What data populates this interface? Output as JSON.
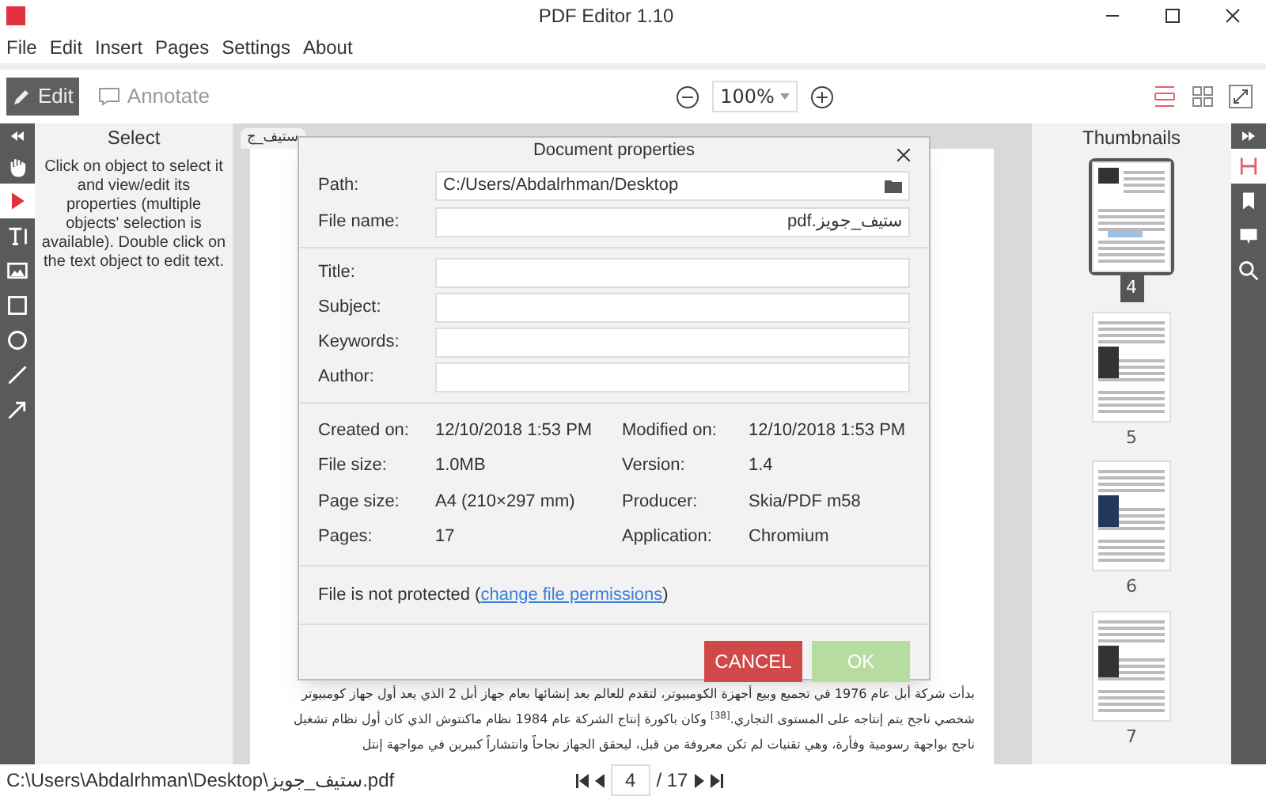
{
  "window": {
    "title": "PDF Editor 1.10"
  },
  "menu": [
    "File",
    "Edit",
    "Insert",
    "Pages",
    "Settings",
    "About"
  ],
  "modes": [
    {
      "label": "Edit",
      "kind": "edit",
      "selected": true
    },
    {
      "label": "Annotate",
      "kind": "annotate",
      "selected": false
    }
  ],
  "zoom": "100%",
  "tools": [
    {
      "kind": "hand",
      "selected": false
    },
    {
      "kind": "pointer",
      "selected": true
    },
    {
      "kind": "text",
      "selected": false
    },
    {
      "kind": "image",
      "selected": false
    },
    {
      "kind": "rect",
      "selected": false
    },
    {
      "kind": "circle",
      "selected": false
    },
    {
      "kind": "line",
      "selected": false
    },
    {
      "kind": "arrow",
      "selected": false
    }
  ],
  "select_panel": {
    "title": "Select",
    "help": "Click on object to select it and view/edit its properties (multiple objects' selection is available).  Double click on the text object to edit text."
  },
  "document": {
    "tab": "ستيف_ج",
    "paragraph": [
      "بدأت شركة أبل عام 1976 في تجميع وبيع أجهزة الكومبيوتر، لتقدم للعالم بعد إنشائها بعام جهاز أبل 2 الذي يعد أول جهاز كومبيوتر",
      "شخصي ناجح يتم إنتاجه على المستوى التجاري.$^{[38]}$ وكان باكورة إنتاج الشركة عام 1984 نظام ماكنتوش الذي كان أول نظام تشغيل",
      "ناجح بواجهة رسومية وفأرة، وهي تقنيات لم تكن معروفة من قبل، ليحقق الجهاز نجاحاً وانتشاراً كبيرين في مواجهة إنتل"
    ]
  },
  "thumbnails": {
    "title": "Thumbnails",
    "pages": [
      {
        "label": "4",
        "selected": true
      },
      {
        "label": "5",
        "selected": false
      },
      {
        "label": "6",
        "selected": false
      },
      {
        "label": "7",
        "selected": false
      }
    ]
  },
  "right_tools": [
    {
      "kind": "thumbnails",
      "selected": true
    },
    {
      "kind": "bookmarks",
      "selected": false
    },
    {
      "kind": "comments",
      "selected": false
    },
    {
      "kind": "search",
      "selected": false
    }
  ],
  "dialog": {
    "title": "Document properties",
    "path": {
      "label": "Path:",
      "value": "C:/Users/Abdalrhman/Desktop"
    },
    "file_name": {
      "label": "File name:",
      "value": "ستيف_جويز.pdf"
    },
    "fields": [
      "Title:",
      "Subject:",
      "Keywords:",
      "Author:"
    ],
    "info": [
      {
        "label": "Created on:",
        "value": "12/10/2018 1:53 PM"
      },
      {
        "label": "Modified on:",
        "value": "12/10/2018 1:53 PM"
      },
      {
        "label": "File size:",
        "value": "1.0MB"
      },
      {
        "label": "Version:",
        "value": "1.4"
      },
      {
        "label": "Page size:",
        "value": "A4 (210×297 mm)"
      },
      {
        "label": "Producer:",
        "value": "Skia/PDF m58"
      },
      {
        "label": "Pages:",
        "value": "17"
      },
      {
        "label": "Application:",
        "value": "Chromium"
      }
    ],
    "protection": {
      "prefix": "File is not protected (",
      "link": "change file permissions",
      "suffix": ")"
    },
    "buttons": [
      {
        "label": "CANCEL",
        "kind": "cancel",
        "disabled": false
      },
      {
        "label": "OK",
        "kind": "ok",
        "disabled": true
      }
    ]
  },
  "status": {
    "path": "C:\\Users\\Abdalrhman\\Desktop\\ستيف_جويز.pdf",
    "page": "4",
    "total": "/ 17"
  }
}
